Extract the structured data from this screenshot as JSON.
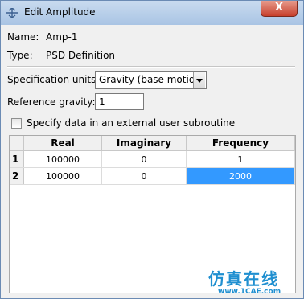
{
  "window": {
    "title": "Edit Amplitude",
    "close_symbol": "X"
  },
  "info": {
    "name_label": "Name:",
    "name_value": "Amp-1",
    "type_label": "Type:",
    "type_value": "PSD Definition"
  },
  "form": {
    "spec_units_label": "Specification units:",
    "spec_units_value": "Gravity (base motion)",
    "ref_gravity_label": "Reference gravity:",
    "ref_gravity_value": "1",
    "external_sub_label": "Specify data in an external user subroutine",
    "external_sub_checked": false
  },
  "table": {
    "columns": [
      "Real",
      "Imaginary",
      "Frequency"
    ],
    "rows": [
      {
        "index": "1",
        "real": "100000",
        "imaginary": "0",
        "frequency": "1"
      },
      {
        "index": "2",
        "real": "100000",
        "imaginary": "0",
        "frequency": "2000"
      }
    ],
    "selected_cell": "2-frequency"
  },
  "watermark": {
    "text": "仿真在线",
    "url": "www.1CAE.com"
  },
  "colors": {
    "titlebar": "#a9c4e4",
    "selection": "#3399ff",
    "watermark": "#1f8fd0"
  }
}
